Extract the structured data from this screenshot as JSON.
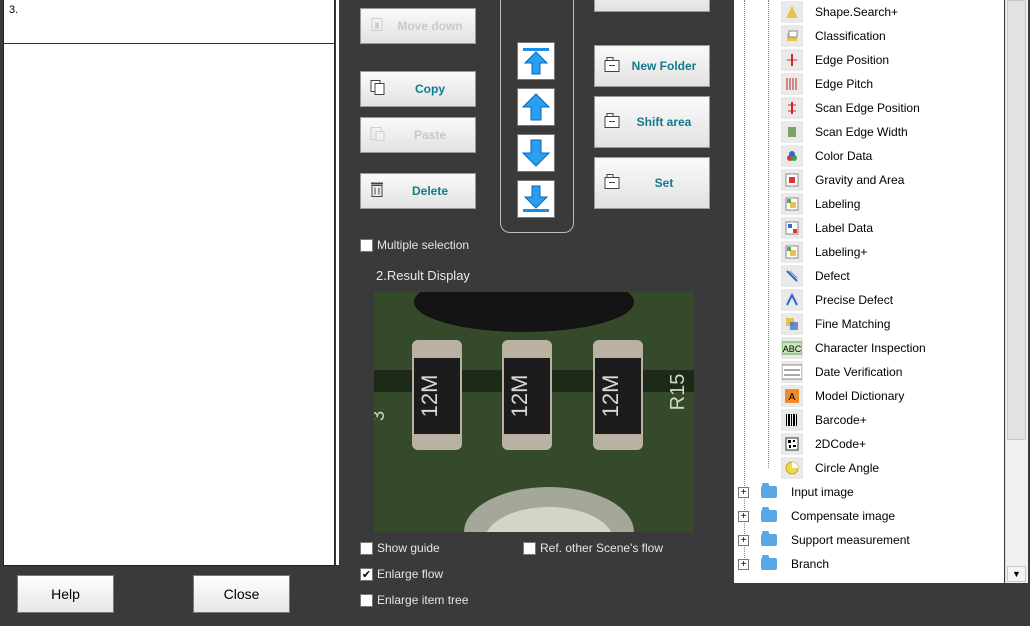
{
  "flow": {
    "row_number": "3."
  },
  "footer": {
    "help_label": "Help",
    "close_label": "Close"
  },
  "edit": {
    "move_down_label": "Move down",
    "copy_label": "Copy",
    "paste_label": "Paste",
    "delete_label": "Delete",
    "new_folder_label": "New Folder",
    "shift_area_label": "Shift area",
    "set_label": "Set"
  },
  "options": {
    "multiple_selection": {
      "label": "Multiple selection",
      "checked": false
    },
    "show_guide": {
      "label": "Show guide",
      "checked": false
    },
    "ref_other_scene": {
      "label": "Ref. other Scene's flow",
      "checked": false
    },
    "enlarge_flow": {
      "label": "Enlarge flow",
      "checked": true
    },
    "enlarge_item_tree": {
      "label": "Enlarge item tree",
      "checked": false
    }
  },
  "preview": {
    "title": "2.Result Display",
    "component_text": "12M",
    "board_text_1": "R15",
    "board_text_2": "3"
  },
  "tree": {
    "items": [
      {
        "label": "Shape.Search+",
        "icon": "shape-search-icon"
      },
      {
        "label": "Classification",
        "icon": "classification-icon"
      },
      {
        "label": "Edge Position",
        "icon": "edge-position-icon"
      },
      {
        "label": "Edge Pitch",
        "icon": "edge-pitch-icon"
      },
      {
        "label": "Scan Edge Position",
        "icon": "scan-edge-position-icon"
      },
      {
        "label": "Scan Edge Width",
        "icon": "scan-edge-width-icon"
      },
      {
        "label": "Color Data",
        "icon": "color-data-icon"
      },
      {
        "label": "Gravity and Area",
        "icon": "gravity-area-icon"
      },
      {
        "label": "Labeling",
        "icon": "labeling-icon"
      },
      {
        "label": "Label Data",
        "icon": "label-data-icon"
      },
      {
        "label": "Labeling+",
        "icon": "labeling-plus-icon"
      },
      {
        "label": "Defect",
        "icon": "defect-icon"
      },
      {
        "label": "Precise Defect",
        "icon": "precise-defect-icon"
      },
      {
        "label": "Fine Matching",
        "icon": "fine-matching-icon"
      },
      {
        "label": "Character Inspection",
        "icon": "character-inspection-icon"
      },
      {
        "label": "Date Verification",
        "icon": "date-verification-icon"
      },
      {
        "label": "Model Dictionary",
        "icon": "model-dictionary-icon"
      },
      {
        "label": "Barcode+",
        "icon": "barcode-icon"
      },
      {
        "label": "2DCode+",
        "icon": "2dcode-icon"
      },
      {
        "label": "Circle Angle",
        "icon": "circle-angle-icon"
      }
    ],
    "folders": [
      {
        "label": "Input image"
      },
      {
        "label": "Compensate image"
      },
      {
        "label": "Support measurement"
      },
      {
        "label": "Branch"
      }
    ]
  }
}
